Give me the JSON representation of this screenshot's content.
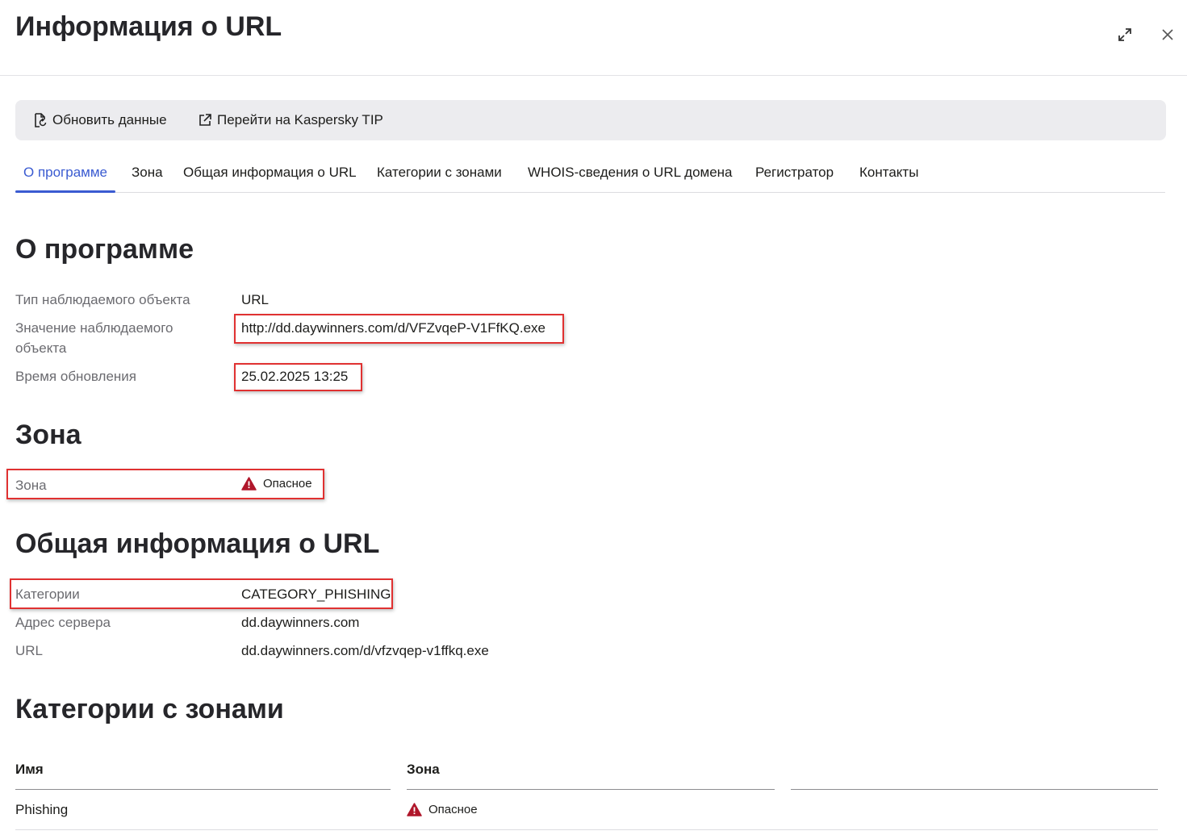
{
  "header": {
    "title": "Информация о URL",
    "expand_icon": "expand-arrows-icon",
    "close_icon": "close-icon"
  },
  "toolbar": {
    "refresh_label": "Обновить данные",
    "refresh_icon": "refresh-file-icon",
    "tip_label": "Перейти на Kaspersky TIP",
    "tip_icon": "external-link-icon"
  },
  "tabs": [
    {
      "label": "О программе",
      "active": true
    },
    {
      "label": "Зона",
      "active": false
    },
    {
      "label": "Общая информация о URL",
      "active": false
    },
    {
      "label": "Категории с зонами",
      "active": false
    },
    {
      "label": "WHOIS-сведения о URL домена",
      "active": false
    },
    {
      "label": "Регистратор",
      "active": false
    },
    {
      "label": "Контакты",
      "active": false
    }
  ],
  "about": {
    "heading": "О программе",
    "rows": [
      {
        "label": "Тип наблюдаемого объекта",
        "value": "URL"
      },
      {
        "label": "Значение наблюдаемого объекта",
        "value": "http://dd.daywinners.com/d/VFZvqeP-V1FfKQ.exe"
      },
      {
        "label": "Время обновления",
        "value": "25.02.2025 13:25"
      }
    ]
  },
  "zone": {
    "heading": "Зона",
    "label": "Зона",
    "value": "Опасное",
    "icon": "warning-triangle-icon",
    "status_color": "#b0172b"
  },
  "general": {
    "heading": "Общая информация о URL",
    "rows": [
      {
        "label": "Категории",
        "value": "CATEGORY_PHISHING"
      },
      {
        "label": "Адрес сервера",
        "value": "dd.daywinners.com"
      },
      {
        "label": "URL",
        "value": "dd.daywinners.com/d/vfzvqep-v1ffkq.exe"
      }
    ]
  },
  "categories": {
    "heading": "Категории с зонами",
    "columns": [
      "Имя",
      "Зона",
      ""
    ],
    "rows": [
      {
        "name": "Phishing",
        "zone": "Опасное"
      }
    ]
  },
  "colors": {
    "accent": "#3a5bd1",
    "highlight": "#e03131",
    "danger": "#b0172b"
  }
}
